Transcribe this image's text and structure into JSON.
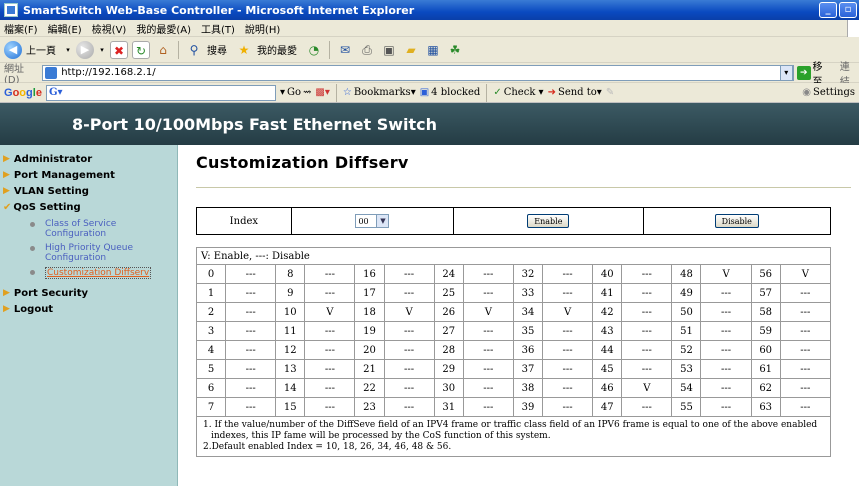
{
  "window": {
    "title": "SmartSwitch Web-Base Controller - Microsoft Internet Explorer"
  },
  "menu": [
    "檔案(F)",
    "編輯(E)",
    "檢視(V)",
    "我的最愛(A)",
    "工具(T)",
    "說明(H)"
  ],
  "navbar": {
    "back_label": "上一頁",
    "search_label": "搜尋",
    "favorites_label": "我的最愛"
  },
  "addressbar": {
    "label": "網址(D)",
    "url": "http://192.168.2.1/",
    "go_label": "移至",
    "links_label": "連結"
  },
  "googlebar": {
    "logo": [
      "G",
      "o",
      "o",
      "g",
      "l",
      "e"
    ],
    "go_label": "Go",
    "bookmarks_label": "Bookmarks▾",
    "blocked_label": "4 blocked",
    "check_label": "Check ▾",
    "sendto_label": "Send to▾",
    "settings_label": "Settings"
  },
  "banner": {
    "title": "8-Port 10/100Mbps Fast Ethernet Switch"
  },
  "sidebar": {
    "items": [
      {
        "label": "Administrator"
      },
      {
        "label": "Port Management"
      },
      {
        "label": "VLAN Setting"
      },
      {
        "label": "QoS Setting"
      }
    ],
    "qos_sub": [
      {
        "label": "Class of Service Configuration"
      },
      {
        "label": "High Priority Queue Configuration"
      },
      {
        "label": "Customization Diffserv"
      }
    ],
    "after": [
      {
        "label": "Port Security"
      },
      {
        "label": "Logout"
      }
    ]
  },
  "content": {
    "title": "Customization Diffserv",
    "index_label": "Index",
    "index_value": "00",
    "enable_label": "Enable",
    "disable_label": "Disable",
    "legend": "V: Enable, ---: Disable",
    "rows": [
      [
        [
          "0",
          "---"
        ],
        [
          "8",
          "---"
        ],
        [
          "16",
          "---"
        ],
        [
          "24",
          "---"
        ],
        [
          "32",
          "---"
        ],
        [
          "40",
          "---"
        ],
        [
          "48",
          "V"
        ],
        [
          "56",
          "V"
        ]
      ],
      [
        [
          "1",
          "---"
        ],
        [
          "9",
          "---"
        ],
        [
          "17",
          "---"
        ],
        [
          "25",
          "---"
        ],
        [
          "33",
          "---"
        ],
        [
          "41",
          "---"
        ],
        [
          "49",
          "---"
        ],
        [
          "57",
          "---"
        ]
      ],
      [
        [
          "2",
          "---"
        ],
        [
          "10",
          "V"
        ],
        [
          "18",
          "V"
        ],
        [
          "26",
          "V"
        ],
        [
          "34",
          "V"
        ],
        [
          "42",
          "---"
        ],
        [
          "50",
          "---"
        ],
        [
          "58",
          "---"
        ]
      ],
      [
        [
          "3",
          "---"
        ],
        [
          "11",
          "---"
        ],
        [
          "19",
          "---"
        ],
        [
          "27",
          "---"
        ],
        [
          "35",
          "---"
        ],
        [
          "43",
          "---"
        ],
        [
          "51",
          "---"
        ],
        [
          "59",
          "---"
        ]
      ],
      [
        [
          "4",
          "---"
        ],
        [
          "12",
          "---"
        ],
        [
          "20",
          "---"
        ],
        [
          "28",
          "---"
        ],
        [
          "36",
          "---"
        ],
        [
          "44",
          "---"
        ],
        [
          "52",
          "---"
        ],
        [
          "60",
          "---"
        ]
      ],
      [
        [
          "5",
          "---"
        ],
        [
          "13",
          "---"
        ],
        [
          "21",
          "---"
        ],
        [
          "29",
          "---"
        ],
        [
          "37",
          "---"
        ],
        [
          "45",
          "---"
        ],
        [
          "53",
          "---"
        ],
        [
          "61",
          "---"
        ]
      ],
      [
        [
          "6",
          "---"
        ],
        [
          "14",
          "---"
        ],
        [
          "22",
          "---"
        ],
        [
          "30",
          "---"
        ],
        [
          "38",
          "---"
        ],
        [
          "46",
          "V"
        ],
        [
          "54",
          "---"
        ],
        [
          "62",
          "---"
        ]
      ],
      [
        [
          "7",
          "---"
        ],
        [
          "15",
          "---"
        ],
        [
          "23",
          "---"
        ],
        [
          "31",
          "---"
        ],
        [
          "39",
          "---"
        ],
        [
          "47",
          "---"
        ],
        [
          "55",
          "---"
        ],
        [
          "63",
          "---"
        ]
      ]
    ],
    "note1": "1. If the value/number of the DiffSeve field of an IPV4 frame or traffic class field of an IPV6 frame is equal to one of the above enabled indexes, this IP fame will be processed by the CoS function of this system.",
    "note2": "2.Default enabled Index = 10, 18, 26, 34, 46, 48 & 56."
  }
}
